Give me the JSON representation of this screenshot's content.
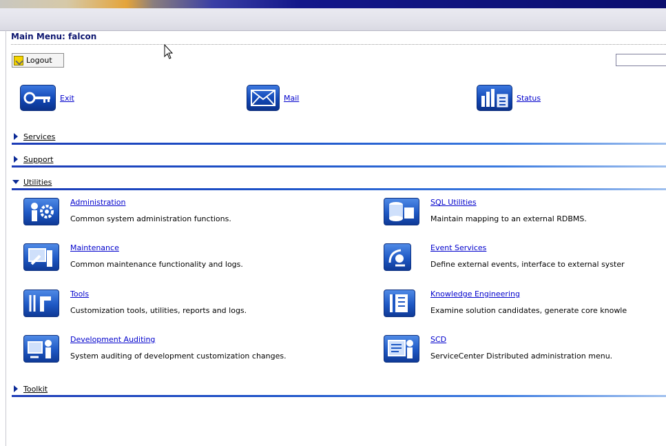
{
  "menu_title": "Main Menu: falcon",
  "logout_label": "Logout",
  "search": {
    "value": ""
  },
  "quick_links": [
    {
      "label": "Exit",
      "icon": "key-icon"
    },
    {
      "label": "Mail",
      "icon": "envelope-icon"
    },
    {
      "label": "Status",
      "icon": "status-chart-icon"
    }
  ],
  "sections": {
    "services": "Services",
    "support": "Support",
    "utilities": "Utilities",
    "toolkit": "Toolkit"
  },
  "utilities": [
    {
      "name": "Administration",
      "description": "Common system administration functions.",
      "icon": "gear-person-icon"
    },
    {
      "name": "SQL Utilities",
      "description": "Maintain mapping to an external RDBMS.",
      "icon": "database-icon"
    },
    {
      "name": "Maintenance",
      "description": "Common maintenance functionality and logs.",
      "icon": "maintenance-icon"
    },
    {
      "name": "Event Services",
      "description": "Define external events, interface to external syster",
      "icon": "satellite-icon"
    },
    {
      "name": "Tools",
      "description": "Customization tools, utilities, reports and logs.",
      "icon": "tools-icon"
    },
    {
      "name": "Knowledge Engineering",
      "description": "Examine solution candidates, generate core knowle",
      "icon": "book-icon"
    },
    {
      "name": "Development Auditing",
      "description": "System auditing of development customization changes.",
      "icon": "auditing-icon"
    },
    {
      "name": "SCD",
      "description": "ServiceCenter Distributed administration menu.",
      "icon": "scd-icon"
    }
  ],
  "colors": {
    "title": "#0d1670",
    "link": "#0000cc",
    "section_rule": "#1c52c8",
    "icon_blue": "#1e58c4"
  }
}
